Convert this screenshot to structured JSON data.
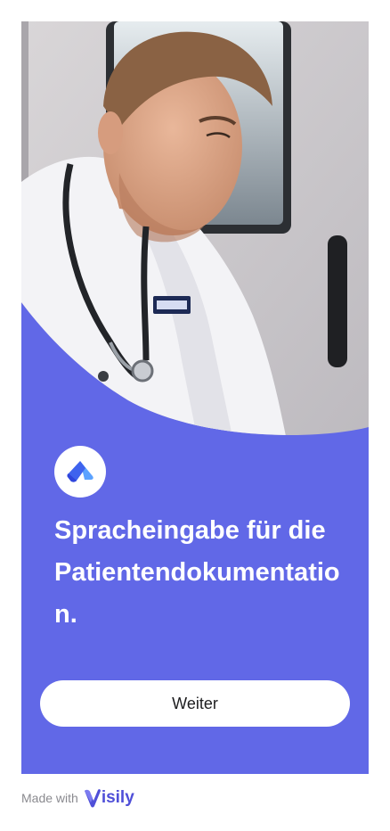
{
  "hero": {
    "image_alt": "Paramedic with stethoscope inside an ambulance"
  },
  "logo": {
    "icon": "app-logo-icon",
    "colors": {
      "light": "#5ba2ff",
      "dark": "#2f45dc"
    }
  },
  "headline": "Spracheingabe für die Patientendokumentation.",
  "continue_button_label": "Weiter",
  "footer": {
    "made_with": "Made with",
    "brand": "isily"
  },
  "colors": {
    "accent": "#6168e7",
    "button_bg": "#ffffff",
    "text_on_accent": "#ffffff"
  }
}
